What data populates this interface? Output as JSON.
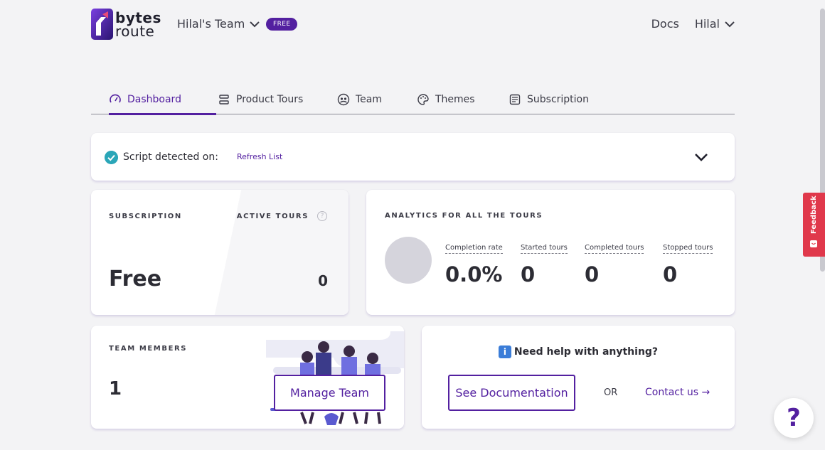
{
  "header": {
    "logo_top": "bytes",
    "logo_bottom": "route",
    "team_name": "Hilal's Team",
    "plan_badge": "FREE",
    "docs_label": "Docs",
    "user_name": "Hilal"
  },
  "tabs": [
    {
      "label": "Dashboard",
      "icon": "gauge-icon",
      "active": true
    },
    {
      "label": "Product Tours",
      "icon": "route-icon",
      "active": false
    },
    {
      "label": "Team",
      "icon": "team-icon",
      "active": false
    },
    {
      "label": "Themes",
      "icon": "palette-icon",
      "active": false
    },
    {
      "label": "Subscription",
      "icon": "receipt-icon",
      "active": false
    }
  ],
  "script": {
    "label": "Script detected on:",
    "refresh_label": "Refresh List"
  },
  "subscription": {
    "label": "SUBSCRIPTION",
    "plan": "Free",
    "active_tours_label": "ACTIVE TOURS",
    "active_tours_value": "0",
    "help_glyph": "?"
  },
  "analytics": {
    "title": "ANALYTICS FOR ALL THE TOURS",
    "metrics": [
      {
        "label": "Completion rate",
        "value": "0.0%"
      },
      {
        "label": "Started tours",
        "value": "0"
      },
      {
        "label": "Completed tours",
        "value": "0"
      },
      {
        "label": "Stopped tours",
        "value": "0"
      }
    ]
  },
  "team": {
    "label": "TEAM MEMBERS",
    "count": "1",
    "manage_label": "Manage Team"
  },
  "help": {
    "title": "Need help with anything?",
    "info_glyph": "i",
    "docs_button": "See Documentation",
    "or_label": "OR",
    "contact_label": "Contact us →"
  },
  "feedback_label": "Feedback",
  "help_fab": "?",
  "colors": {
    "brand": "#5320a0",
    "check": "#2aa6b8",
    "feedback": "#e0384b"
  }
}
